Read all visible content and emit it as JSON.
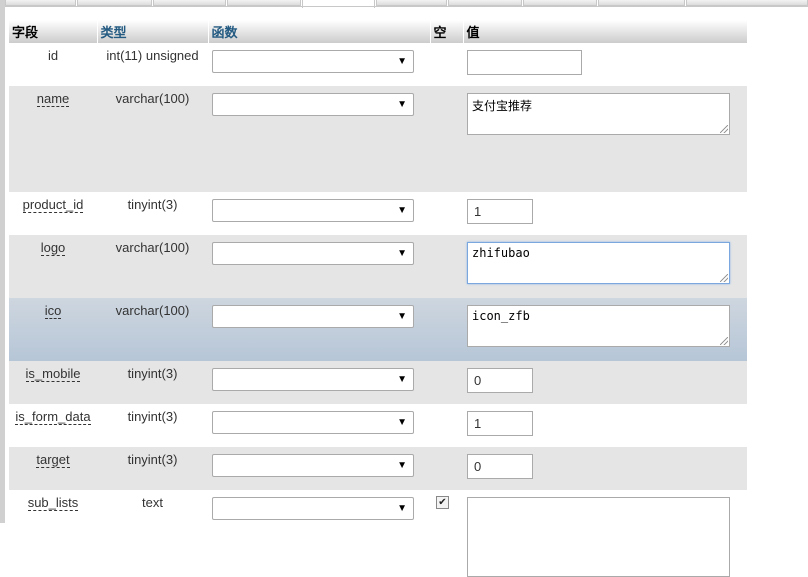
{
  "headers": {
    "field": "字段",
    "type": "类型",
    "function": "函数",
    "null": "空",
    "value": "值"
  },
  "rows": [
    {
      "field": "id",
      "type": "int(11) unsigned",
      "value": "",
      "null_checked": false
    },
    {
      "field": "name",
      "type": "varchar(100)",
      "value": "支付宝推荐",
      "null_checked": false
    },
    {
      "field": "product_id",
      "type": "tinyint(3)",
      "value": "1",
      "null_checked": false
    },
    {
      "field": "logo",
      "type": "varchar(100)",
      "value": "zhifubao",
      "null_checked": false
    },
    {
      "field": "ico",
      "type": "varchar(100)",
      "value": "icon_zfb",
      "null_checked": false
    },
    {
      "field": "is_mobile",
      "type": "tinyint(3)",
      "value": "0",
      "null_checked": false
    },
    {
      "field": "is_form_data",
      "type": "tinyint(3)",
      "value": "1",
      "null_checked": false
    },
    {
      "field": "target",
      "type": "tinyint(3)",
      "value": "0",
      "null_checked": false
    },
    {
      "field": "sub_lists",
      "type": "text",
      "value": "",
      "null_checked": true
    }
  ],
  "icons": {
    "dropdown": "chevron-down-icon",
    "checkbox": "checkmark-icon",
    "resize": "resize-grip-icon"
  },
  "glyphs": {
    "arrow": "▼",
    "check": "✔"
  },
  "colors": {
    "header_text": "#235a81",
    "row_even": "#e5e5e5",
    "row_marked": "#c2cfdc",
    "focus_border": "#7aa7dd"
  }
}
